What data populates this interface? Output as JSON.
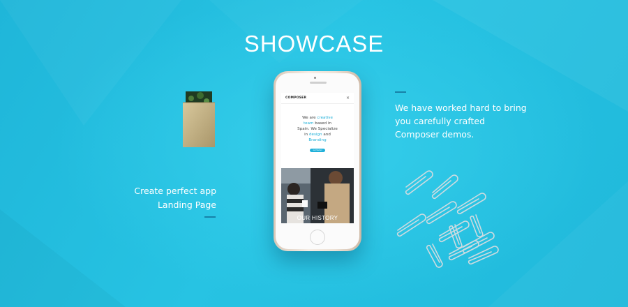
{
  "section": {
    "title": "SHOWCASE"
  },
  "left_feature": {
    "line1": "Create perfect app",
    "line2": "Landing Page"
  },
  "right_feature": {
    "line1": "We have worked hard to bring",
    "line2": "you carefully crafted",
    "line3": "Composer demos."
  },
  "phone_screen": {
    "brand": "COMPOSER",
    "close_glyph": "×",
    "intro": {
      "l1a": "We are ",
      "l1b": "creative",
      "l2a": "team",
      "l2b": " based in",
      "l3": "Spain. We Specialize",
      "l4a": "in ",
      "l4b": "design",
      "l4c": " and",
      "l5": "Branding"
    },
    "cta": "Get Started",
    "photo_caption": "OUR HISTORY"
  },
  "colors": {
    "background": "#23bfe0",
    "accent": "#1fb0d9",
    "rule": "#1782a8",
    "phone_frame": "#eee2d6"
  }
}
